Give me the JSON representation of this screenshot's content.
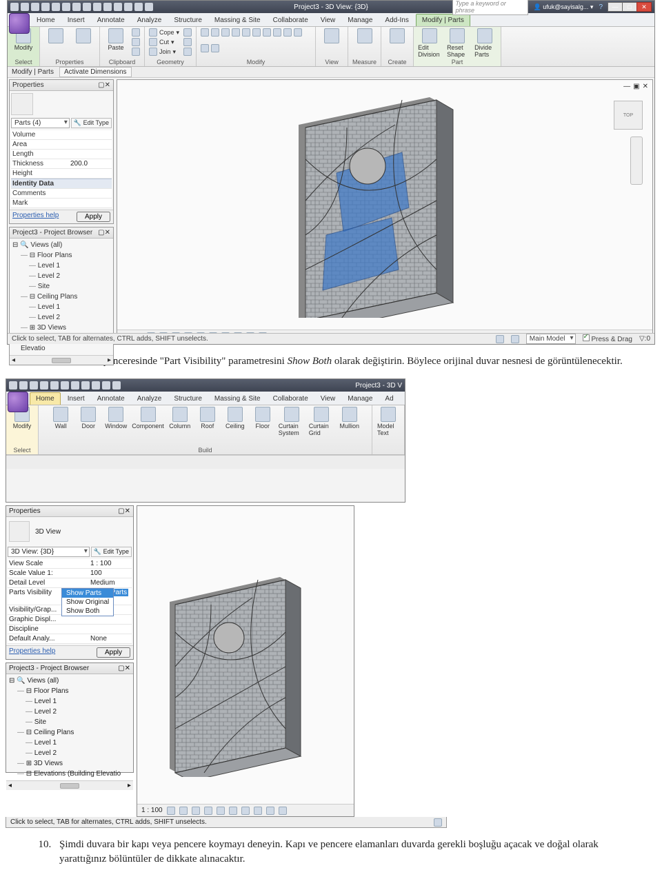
{
  "titlebar": {
    "title": "Project3 - 3D View: {3D}",
    "search_placeholder": "Type a keyword or phrase",
    "user": "ufuk@sayisalg..."
  },
  "tabs": [
    "Home",
    "Insert",
    "Annotate",
    "Analyze",
    "Structure",
    "Massing & Site",
    "Collaborate",
    "View",
    "Manage",
    "Add-Ins",
    "Modify | Parts"
  ],
  "tabs2": [
    "Home",
    "Insert",
    "Annotate",
    "Analyze",
    "Structure",
    "Massing & Site",
    "Collaborate",
    "View",
    "Manage",
    "Ad"
  ],
  "ribbon1": {
    "modify": "Modify",
    "select": "Select",
    "properties": "Properties",
    "clipboard": "Clipboard",
    "paste": "Paste",
    "cope": "Cope",
    "cut": "Cut",
    "join": "Join",
    "geometry": "Geometry",
    "modify_grp": "Modify",
    "view": "View",
    "measure": "Measure",
    "create": "Create",
    "edit_division": "Edit Division",
    "reset_shape": "Reset Shape",
    "divide_parts": "Divide Parts",
    "part": "Part"
  },
  "ribbon2": {
    "modify": "Modify",
    "select": "Select",
    "wall": "Wall",
    "door": "Door",
    "window": "Window",
    "component": "Component",
    "column": "Column",
    "roof": "Roof",
    "ceiling": "Ceiling",
    "floor": "Floor",
    "curtain_system": "Curtain System",
    "curtain_grid": "Curtain Grid",
    "mullion": "Mullion",
    "model_text": "Model Text",
    "build": "Build"
  },
  "context": {
    "label": "Modify | Parts",
    "button": "Activate Dimensions"
  },
  "properties1": {
    "title": "Properties",
    "type": "Parts (4)",
    "edit_type": "Edit Type",
    "rows": {
      "volume": "Volume",
      "area": "Area",
      "length": "Length",
      "thickness": "Thickness",
      "thickness_val": "200.0",
      "height": "Height",
      "identity": "Identity Data",
      "comments": "Comments",
      "mark": "Mark"
    },
    "help": "Properties help",
    "apply": "Apply"
  },
  "properties2": {
    "title": "Properties",
    "type": "3D View",
    "view_name": "3D View: {3D}",
    "edit_type": "Edit Type",
    "rows": {
      "view_scale": "View Scale",
      "view_scale_val": "1 : 100",
      "scale_value": "Scale Value   1:",
      "scale_value_val": "100",
      "detail_level": "Detail Level",
      "detail_level_val": "Medium",
      "parts_visibility": "Parts Visibility",
      "parts_visibility_val": "Show Parts",
      "vis_graph": "Visibility/Grap...",
      "graphic_displ": "Graphic Displ...",
      "discipline": "Discipline",
      "default_analy": "Default Analy...",
      "default_analy_val": "None"
    },
    "combo": {
      "o1": "Show Parts",
      "o2": "Show Original",
      "o3": "Show Both"
    },
    "help": "Properties help",
    "apply": "Apply"
  },
  "browser": {
    "title": "Project3 - Project Browser",
    "views_all": "Views (all)",
    "floor_plans": "Floor Plans",
    "level1": "Level 1",
    "level2": "Level 2",
    "site": "Site",
    "ceiling_plans": "Ceiling Plans",
    "threed": "3D Views",
    "elevations": "Elevations (Building Elevatio"
  },
  "viewbar": {
    "scale": "1 : 100"
  },
  "status": {
    "left": "Click to select, TAB for alternates, CTRL adds, SHIFT unselects.",
    "model": "Main Model",
    "pressdrag": "Press & Drag",
    "filter": "0"
  },
  "steps": {
    "n9": "Özellikler penceresinde \"Part Visibility\" parametresini ",
    "n9i": "Show Both",
    "n9b": " olarak değiştirin. Böylece orijinal duvar nesnesi de görüntülenecektir.",
    "n10": "Şimdi duvara bir kapı veya pencere koymayı deneyin. Kapı ve pencere elamanları duvarda gerekli boşluğu açacak ve doğal olarak yarattığınız bölüntüler de dikkate alınacaktır."
  }
}
